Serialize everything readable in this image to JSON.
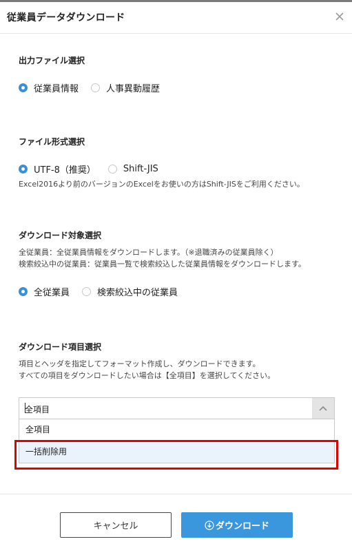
{
  "dialog": {
    "title": "従業員データダウンロード",
    "close_icon": "close-icon"
  },
  "output_file": {
    "heading": "出力ファイル選択",
    "options": [
      {
        "label": "従業員情報",
        "checked": true
      },
      {
        "label": "人事異動履歴",
        "checked": false
      }
    ]
  },
  "file_format": {
    "heading": "ファイル形式選択",
    "options": [
      {
        "label": "UTF-8（推奨）",
        "checked": true
      },
      {
        "label": "Shift-JIS",
        "checked": false
      }
    ],
    "note": "Excel2016より前のバージョンのExcelをお使いの方はShift-JISをご利用ください。"
  },
  "download_target": {
    "heading": "ダウンロード対象選択",
    "desc_line1": "全従業員：全従業員情報をダウンロードします。（※退職済みの従業員除く）",
    "desc_line2": "検索絞込中の従業員：従業員一覧で検索絞込した従業員情報をダウンロードします。",
    "options": [
      {
        "label": "全従業員",
        "checked": true
      },
      {
        "label": "検索絞込中の従業員",
        "checked": false
      }
    ]
  },
  "download_items": {
    "heading": "ダウンロード項目選択",
    "desc_line1": "項目とヘッダを指定してフォーマット作成し、ダウンロードできます。",
    "desc_line2": "すべての項目をダウンロードしたい場合は【全項目】を選択してください。",
    "select_value": "全項目",
    "dropdown_options": [
      "全項目",
      "一括削除用"
    ],
    "highlighted_option": "一括削除用"
  },
  "footer": {
    "cancel_label": "キャンセル",
    "download_label": "ダウンロード",
    "download_icon": "download-icon"
  },
  "colors": {
    "accent": "#3a96dd",
    "highlight_border": "#e00000"
  }
}
